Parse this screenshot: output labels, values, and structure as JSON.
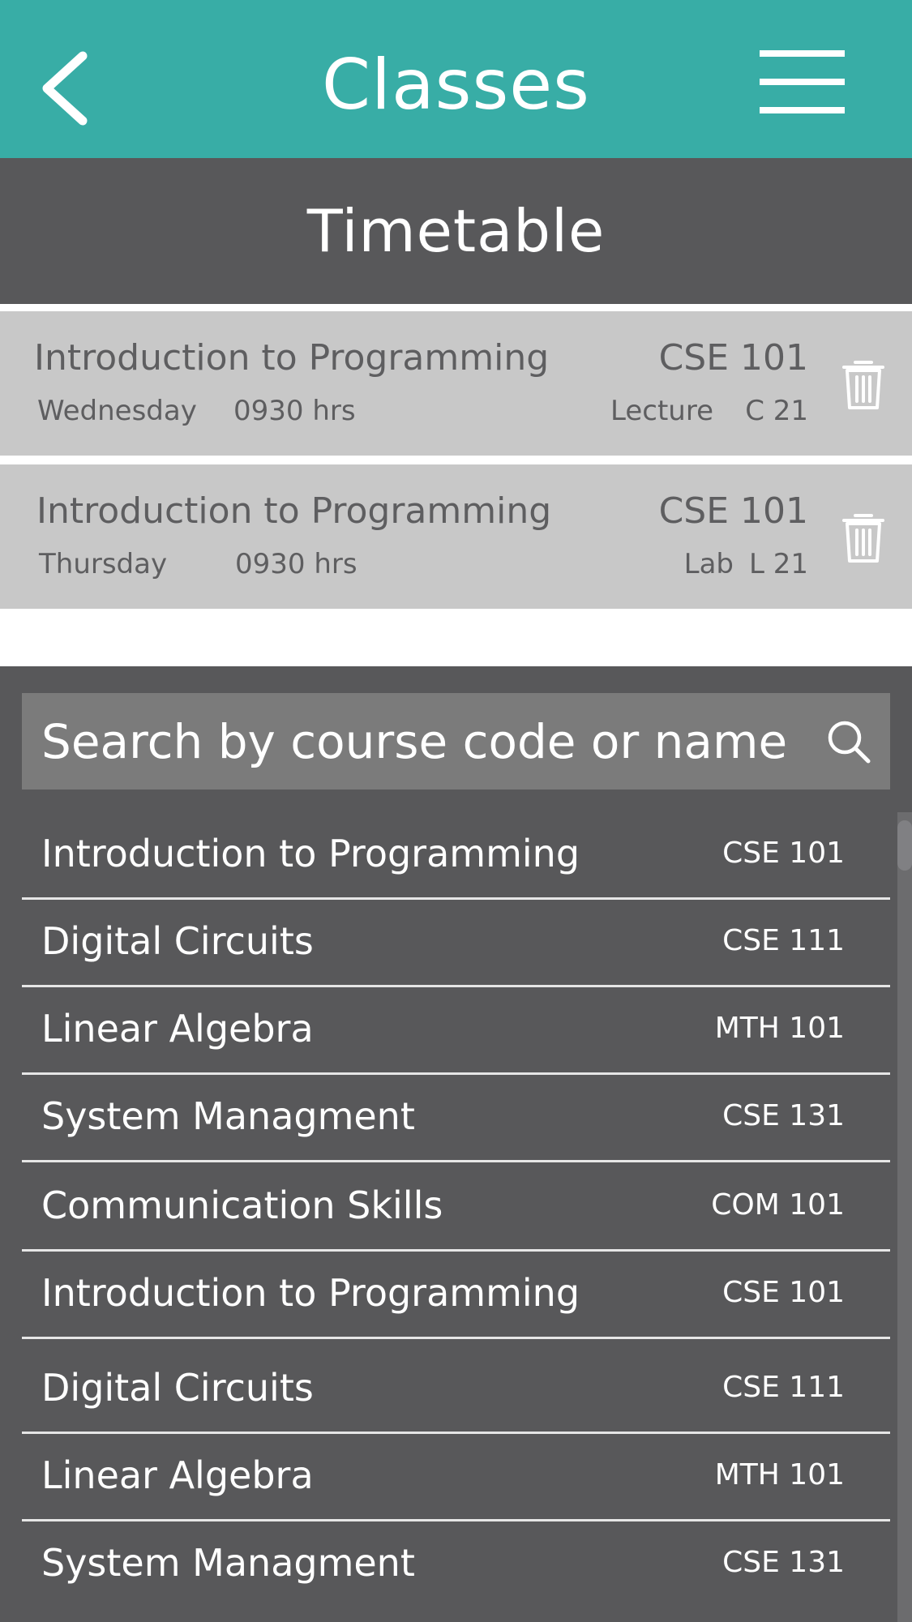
{
  "header": {
    "title": "Classes",
    "back_icon": "chevron-left-icon",
    "menu_icon": "hamburger-menu-icon"
  },
  "timetable": {
    "title": "Timetable",
    "entries": [
      {
        "name": "Introduction to Programming",
        "code": "CSE 101",
        "day": "Wednesday",
        "time": "0930 hrs",
        "type": "Lecture",
        "room": "C 21"
      },
      {
        "name": "Introduction to Programming",
        "code": "CSE 101",
        "day": "Thursday",
        "time": "0930 hrs",
        "type": "Lab",
        "room": "L 21"
      }
    ]
  },
  "search": {
    "placeholder": "Search by course code or name"
  },
  "courses": [
    {
      "name": "Introduction to Programming",
      "code": "CSE 101"
    },
    {
      "name": "Digital Circuits",
      "code": "CSE 111"
    },
    {
      "name": "Linear Algebra",
      "code": "MTH 101"
    },
    {
      "name": "System Managment",
      "code": "CSE 131"
    },
    {
      "name": "Communication Skills",
      "code": "COM 101"
    },
    {
      "name": "Introduction to Programming",
      "code": "CSE 101"
    },
    {
      "name": "Digital Circuits",
      "code": "CSE 111"
    },
    {
      "name": "Linear Algebra",
      "code": "MTH 101"
    },
    {
      "name": "System Managment",
      "code": "CSE 131"
    }
  ],
  "colors": {
    "accent": "#38ada6",
    "dark_panel": "#58585a",
    "entry_bg": "#c8c8c8",
    "search_bg": "#7b7b7b"
  }
}
